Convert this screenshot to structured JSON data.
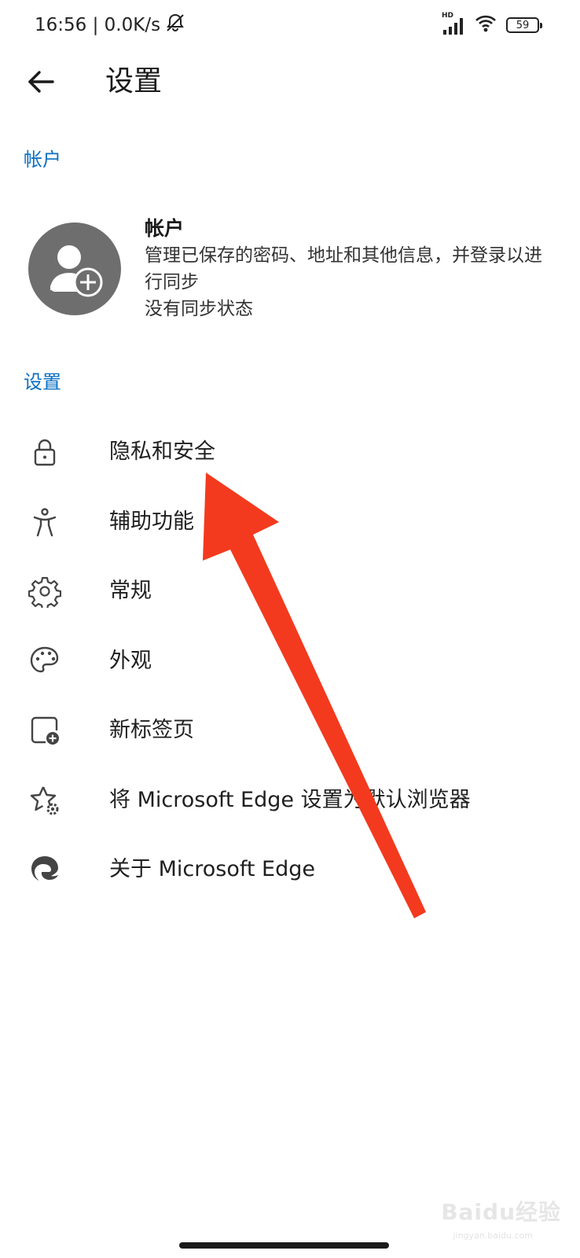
{
  "status_bar": {
    "time_and_speed": "16:56 | 0.0K/s",
    "network_label": "HD",
    "battery_level": "59"
  },
  "app_bar": {
    "title": "设置"
  },
  "sections": {
    "account_header": "帐户",
    "settings_header": "设置"
  },
  "account": {
    "title": "帐户",
    "description": "管理已保存的密码、地址和其他信息，并登录以进行同步",
    "sync_status": "没有同步状态"
  },
  "menu": {
    "items": [
      {
        "label": "隐私和安全",
        "icon": "lock-icon"
      },
      {
        "label": "辅助功能",
        "icon": "accessibility-icon"
      },
      {
        "label": "常规",
        "icon": "gear-icon"
      },
      {
        "label": "外观",
        "icon": "palette-icon"
      },
      {
        "label": "新标签页",
        "icon": "new-tab-icon"
      },
      {
        "label": "将 Microsoft Edge 设置为默认浏览器",
        "icon": "star-gear-icon"
      },
      {
        "label": "关于 Microsoft Edge",
        "icon": "edge-logo-icon"
      }
    ]
  },
  "watermark": {
    "text": "Baidu经验",
    "sub": "jingyan.baidu.com"
  },
  "colors": {
    "accent": "#0a6fc2",
    "annotation_arrow": "#f33a1e",
    "avatar_bg": "#6e6e6e"
  }
}
